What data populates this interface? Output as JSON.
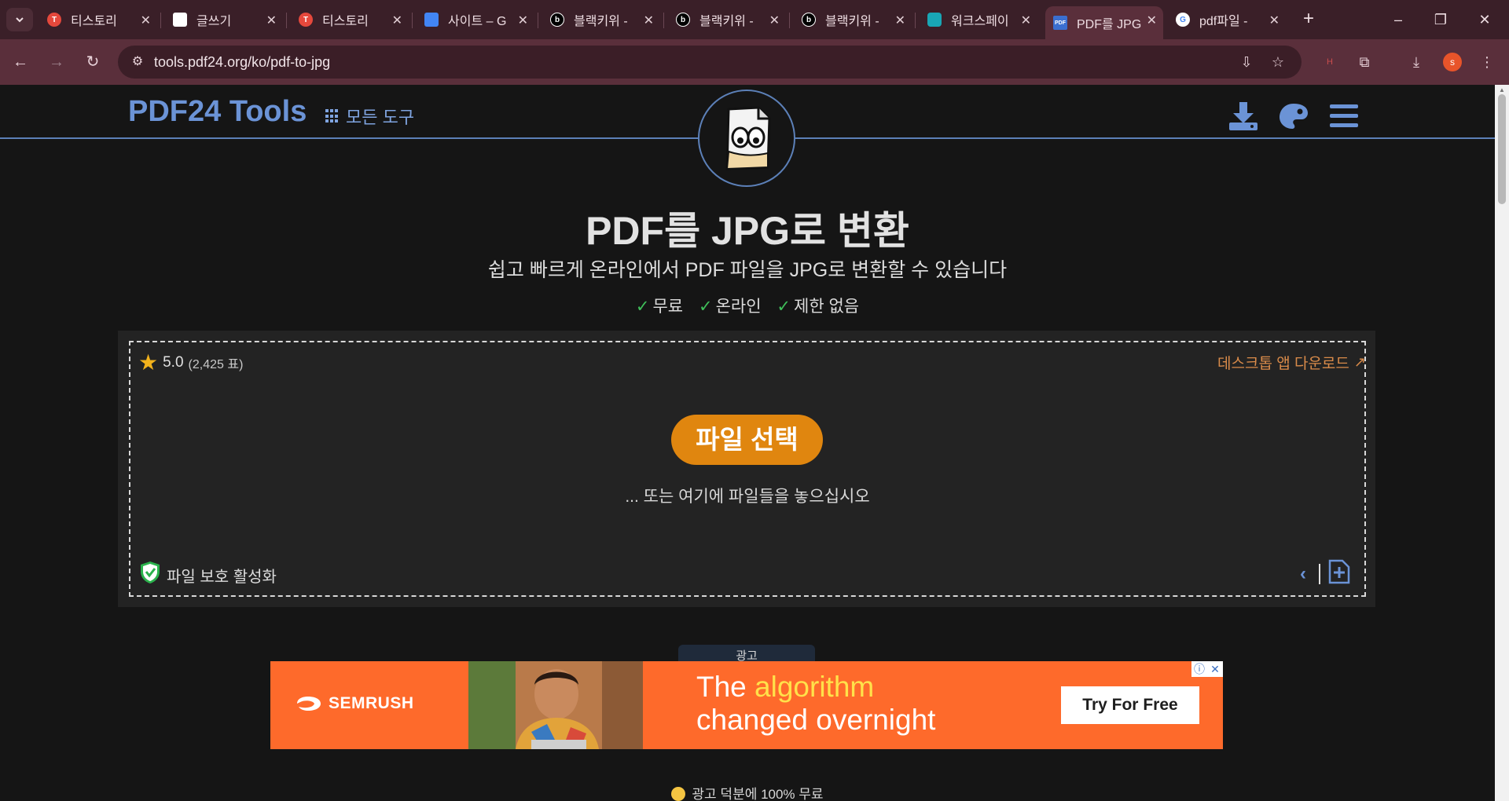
{
  "browser": {
    "tabs": [
      {
        "label": "티스토리",
        "favicon": "tistory-icon",
        "color": "#e5483c"
      },
      {
        "label": "글쓰기",
        "favicon": "write-icon",
        "color": "#ffffff"
      },
      {
        "label": "티스토리",
        "favicon": "tistory-icon",
        "color": "#e5483c"
      },
      {
        "label": "사이트 – G",
        "favicon": "adsense-icon",
        "color": "#4285f4"
      },
      {
        "label": "블랙키위 -",
        "favicon": "blackkiwi-icon",
        "color": "#000000"
      },
      {
        "label": "블랙키위 -",
        "favicon": "blackkiwi-icon",
        "color": "#000000"
      },
      {
        "label": "블랙키위 -",
        "favicon": "blackkiwi-icon",
        "color": "#000000"
      },
      {
        "label": "워크스페이",
        "favicon": "workspace-icon",
        "color": "#19a6b5"
      },
      {
        "label": "PDF를 JPG",
        "favicon": "pdf24-icon",
        "color": "#3b6fd0",
        "active": true
      },
      {
        "label": "pdf파일 -",
        "favicon": "google-icon",
        "color": "#ffffff"
      }
    ],
    "url": "tools.pdf24.org/ko/pdf-to-jpg"
  },
  "header": {
    "brand": "PDF24 Tools",
    "all_tools": "모든 도구"
  },
  "hero": {
    "title": "PDF를 JPG로 변환",
    "subtitle": "쉽고 빠르게 온라인에서 PDF 파일을 JPG로 변환할 수 있습니다",
    "features": [
      "무료",
      "온라인",
      "제한 없음"
    ]
  },
  "upload": {
    "rating": "5.0",
    "votes": "(2,425 표)",
    "desktop_download": "데스크톱 앱 다운로드",
    "select_button": "파일 선택",
    "drop_hint": "... 또는 여기에 파일들을 놓으십시오",
    "protection": "파일 보호 활성화"
  },
  "ad": {
    "label": "광고",
    "brand": "SEMRUSH",
    "headline_pre": "The ",
    "headline_highlight": "algorithm",
    "headline_line2": "changed overnight",
    "cta": "Try For Free"
  },
  "footer_note": "광고 덕분에 100% 무료",
  "colors": {
    "accent": "#6b93d6",
    "button": "#e0860f",
    "check": "#3fbf5a",
    "ad_bg": "#fe6a2b"
  }
}
